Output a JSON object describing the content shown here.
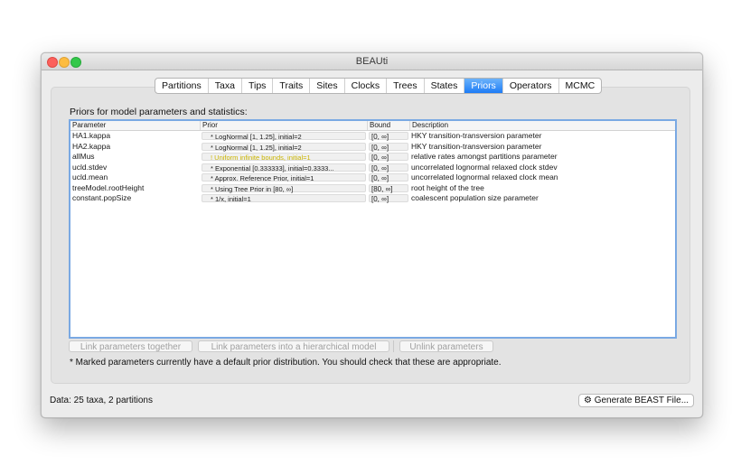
{
  "window": {
    "title": "BEAUti"
  },
  "tabs": [
    {
      "label": "Partitions",
      "active": false
    },
    {
      "label": "Taxa",
      "active": false
    },
    {
      "label": "Tips",
      "active": false
    },
    {
      "label": "Traits",
      "active": false
    },
    {
      "label": "Sites",
      "active": false
    },
    {
      "label": "Clocks",
      "active": false
    },
    {
      "label": "Trees",
      "active": false
    },
    {
      "label": "States",
      "active": false
    },
    {
      "label": "Priors",
      "active": true
    },
    {
      "label": "Operators",
      "active": false
    },
    {
      "label": "MCMC",
      "active": false
    }
  ],
  "priors": {
    "heading": "Priors for model parameters and statistics:",
    "columns": {
      "parameter": "Parameter",
      "prior": "Prior",
      "bound": "Bound",
      "description": "Description"
    },
    "rows": [
      {
        "parameter": "HA1.kappa",
        "prior": "* LogNormal [1, 1.25], initial=2",
        "bound": "[0, ∞]",
        "description": "HKY transition-transversion parameter",
        "warning": false
      },
      {
        "parameter": "HA2.kappa",
        "prior": "* LogNormal [1, 1.25], initial=2",
        "bound": "[0, ∞]",
        "description": "HKY transition-transversion parameter",
        "warning": false
      },
      {
        "parameter": "allMus",
        "prior": "! Uniform infinite bounds, initial=1",
        "bound": "[0, ∞]",
        "description": "relative rates amongst partitions parameter",
        "warning": true
      },
      {
        "parameter": "ucld.stdev",
        "prior": "* Exponential [0.333333], initial=0.3333...",
        "bound": "[0, ∞]",
        "description": "uncorrelated lognormal relaxed clock stdev",
        "warning": false
      },
      {
        "parameter": "ucld.mean",
        "prior": "* Approx. Reference Prior, initial=1",
        "bound": "[0, ∞]",
        "description": "uncorrelated lognormal relaxed clock mean",
        "warning": false
      },
      {
        "parameter": "treeModel.rootHeight",
        "prior": "* Using Tree Prior in [80, ∞]",
        "bound": "[80, ∞]",
        "description": "root height of the tree",
        "warning": false
      },
      {
        "parameter": "constant.popSize",
        "prior": "* 1/x, initial=1",
        "bound": "[0, ∞]",
        "description": "coalescent population size parameter",
        "warning": false
      }
    ],
    "buttons": {
      "link": "Link parameters together",
      "link_hierarchical": "Link parameters into a hierarchical model",
      "unlink": "Unlink parameters"
    },
    "note": "* Marked parameters currently have a default prior distribution. You should check that these are appropriate."
  },
  "status": {
    "data": "Data: 25 taxa, 2 partitions",
    "generate_icon": "gear-icon",
    "generate_label": "Generate BEAST File..."
  },
  "colors": {
    "accent": "#1e7cf6",
    "warning_text": "#c9b400",
    "table_border": "#7aa9e3"
  }
}
